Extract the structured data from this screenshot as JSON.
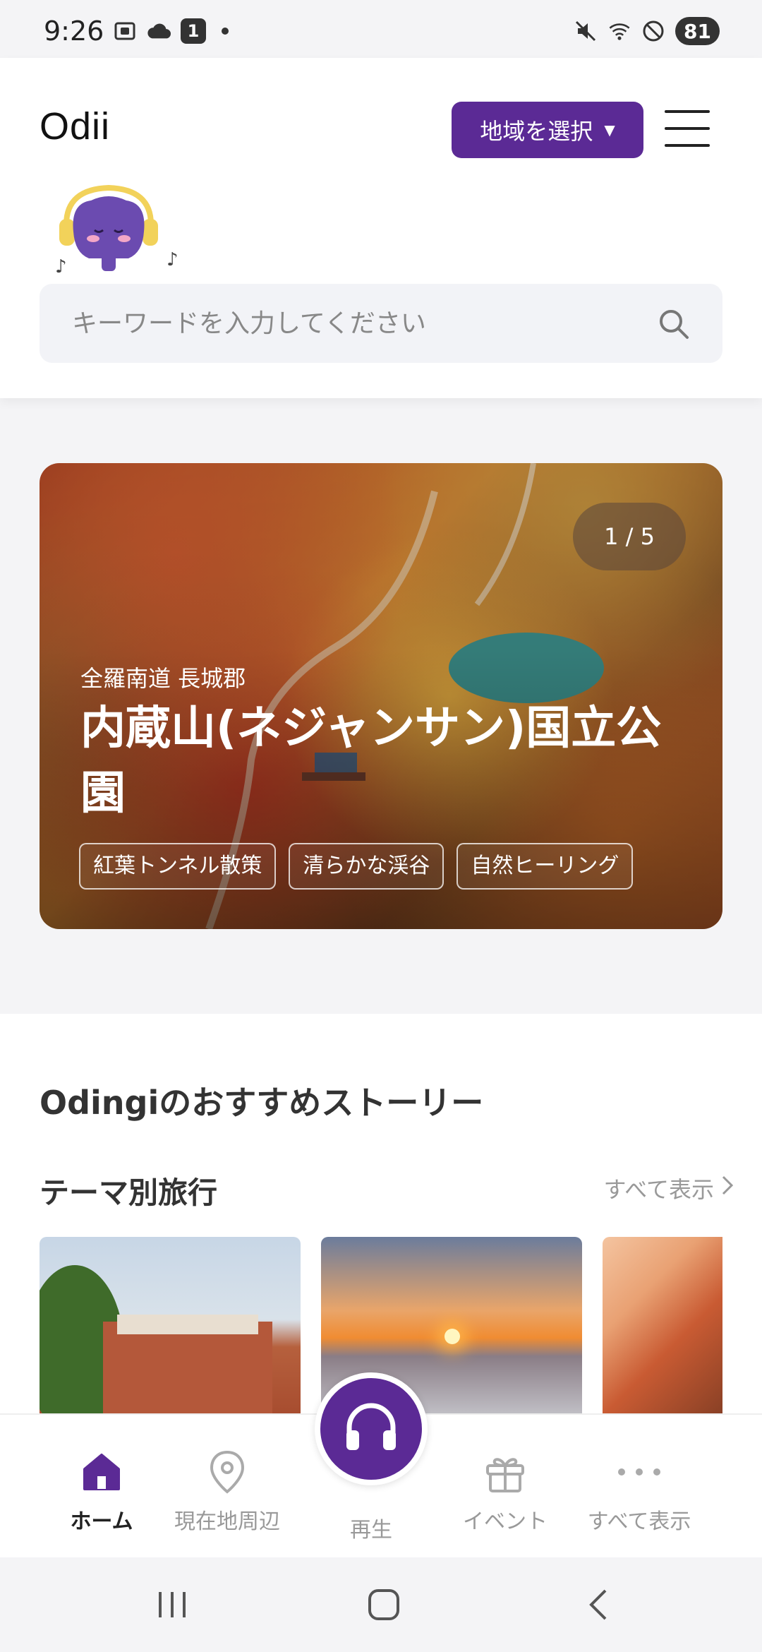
{
  "status_bar": {
    "time": "9:26",
    "notification_count": "1",
    "battery": "81"
  },
  "header": {
    "logo": "Odii",
    "region_button": "地域を選択",
    "search_placeholder": "キーワードを入力してください"
  },
  "hero": {
    "counter": "1 / 5",
    "location": "全羅南道 長城郡",
    "title": "内蔵山(ネジャンサン)国立公園",
    "tags": [
      "紅葉トンネル散策",
      "清らかな渓谷",
      "自然ヒーリング"
    ]
  },
  "recommend": {
    "section_title": "Odingiのおすすめストーリー",
    "subsection_title": "テーマ別旅行",
    "see_all": "すべて表示"
  },
  "bottom_nav": {
    "home": "ホーム",
    "nearby": "現在地周辺",
    "play": "再生",
    "event": "イベント",
    "more": "すべて表示"
  },
  "colors": {
    "brand": "#5b2a95",
    "inactive": "#999999"
  }
}
